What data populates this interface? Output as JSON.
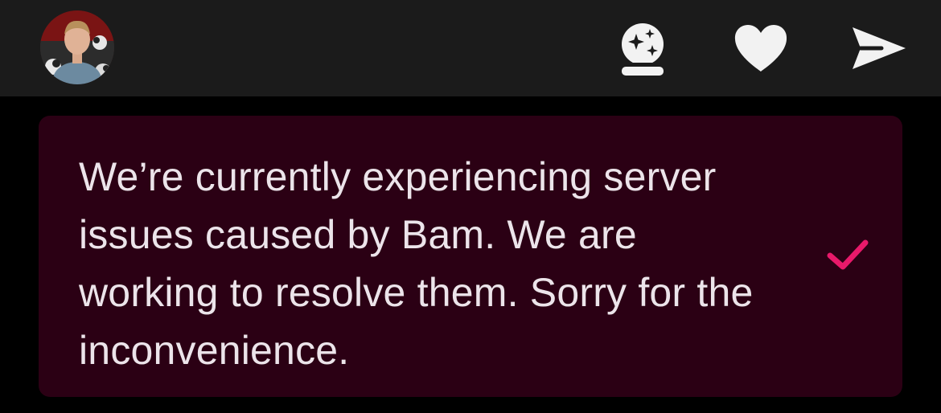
{
  "header": {
    "avatar_icon": "user-avatar-photo",
    "actions": [
      {
        "icon": "crystal-ball-sparkle-icon"
      },
      {
        "icon": "heart-icon"
      },
      {
        "icon": "send-icon"
      }
    ],
    "icon_color": "#f2f2f2"
  },
  "notice": {
    "message": "We’re currently experiencing server issues caused by Bam. We are working to resolve them. Sorry for the inconvenience.",
    "status_icon": "checkmark-icon",
    "accent_color": "#e8196a",
    "background_color": "#2b0014"
  }
}
